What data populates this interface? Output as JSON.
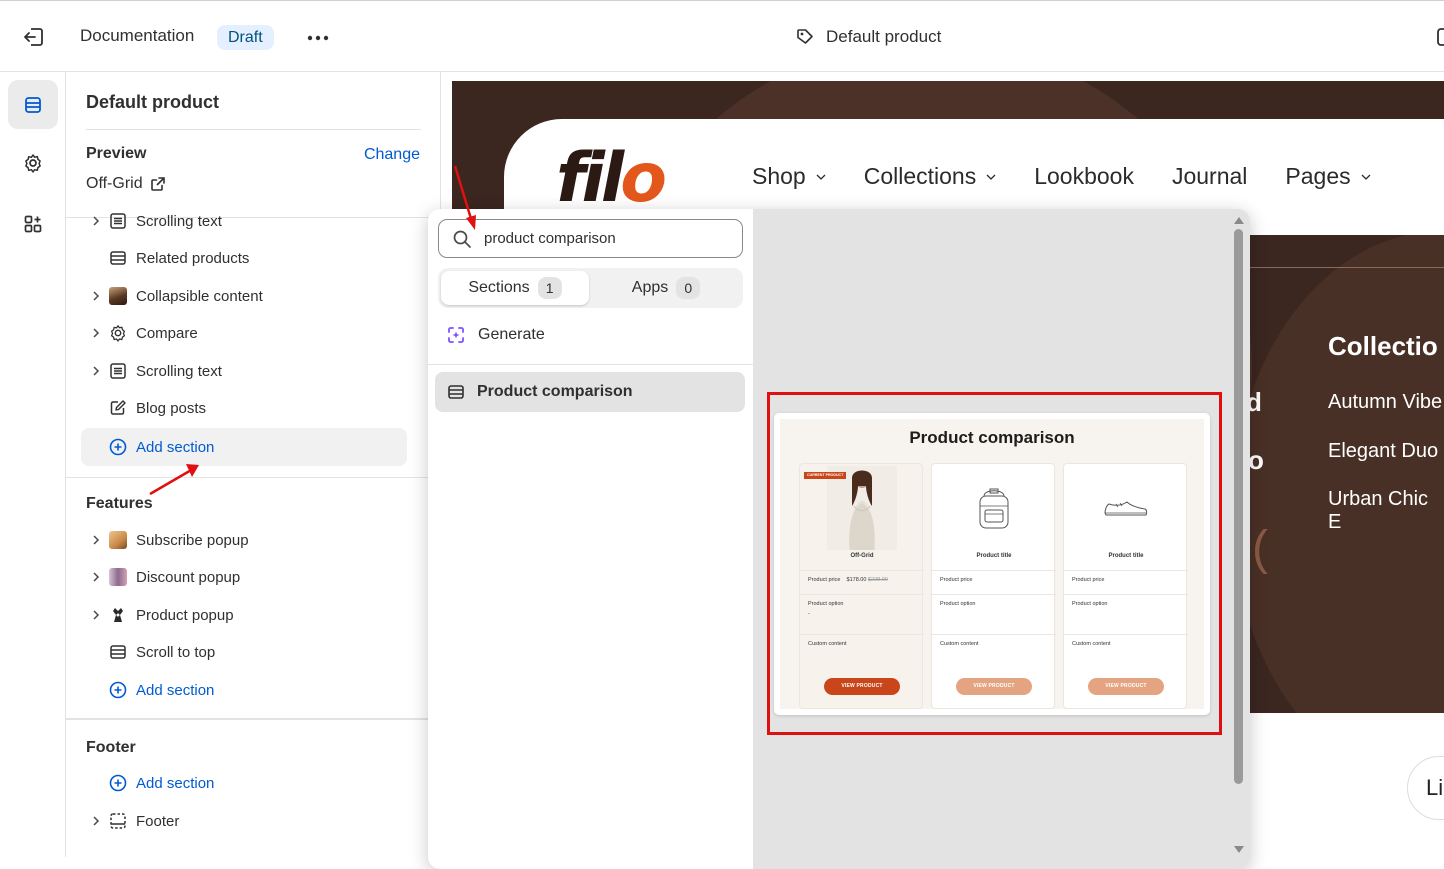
{
  "topbar": {
    "doc_title": "Documentation",
    "status_badge": "Draft",
    "page_title": "Default product"
  },
  "sidebar": {
    "title": "Default product",
    "preview_label": "Preview",
    "change_link": "Change",
    "preview_value": "Off-Grid",
    "template_items": [
      {
        "label": "Scrolling text",
        "icon": "list-icon"
      },
      {
        "label": "Related products",
        "icon": "section-icon"
      },
      {
        "label": "Collapsible content",
        "icon": "image-thumb"
      },
      {
        "label": "Compare",
        "icon": "gear-icon"
      },
      {
        "label": "Scrolling text",
        "icon": "list-icon"
      },
      {
        "label": "Blog posts",
        "icon": "blog-icon"
      }
    ],
    "add_section": "Add section",
    "features_title": "Features",
    "feature_items": [
      {
        "label": "Subscribe popup",
        "icon": "image-thumb"
      },
      {
        "label": "Discount popup",
        "icon": "image-thumb"
      },
      {
        "label": "Product popup",
        "icon": "image-thumb"
      },
      {
        "label": "Scroll to top",
        "icon": "section-icon"
      }
    ],
    "features_add_section": "Add section",
    "footer_title": "Footer",
    "footer_add_section": "Add section",
    "footer_item": "Footer"
  },
  "site": {
    "logo_text": "fil",
    "logo_accent": "o",
    "menu": [
      {
        "label": "Shop",
        "dropdown": true
      },
      {
        "label": "Collections",
        "dropdown": true
      },
      {
        "label": "Lookbook",
        "dropdown": false
      },
      {
        "label": "Journal",
        "dropdown": false
      },
      {
        "label": "Pages",
        "dropdown": true
      }
    ],
    "collections_title": "Collectio",
    "collections": [
      "Autumn Vibe",
      "Elegant Duo",
      "Urban Chic E"
    ],
    "partial_1": "d",
    "partial_2": "o",
    "partial_3": "(",
    "chat_label": "Li"
  },
  "popover": {
    "search_value": "product comparison",
    "tabs": {
      "sections_label": "Sections",
      "sections_count": "1",
      "apps_label": "Apps",
      "apps_count": "0"
    },
    "generate_label": "Generate",
    "result_label": "Product comparison"
  },
  "preview_card": {
    "title": "Product comparison",
    "current_badge": "CURRENT PRODUCT",
    "columns": [
      {
        "name": "Off-Grid",
        "price_label": "Product price",
        "price": "$178.00",
        "compare_price": "$228.00",
        "option_label": "Product option",
        "option_value": "-",
        "custom_label": "Custom content",
        "button": "VIEW PRODUCT",
        "button_color": "#c9461a"
      },
      {
        "name": "Product title",
        "price_label": "Product price",
        "price": "",
        "compare_price": "",
        "option_label": "Product option",
        "option_value": "",
        "custom_label": "Custom content",
        "button": "VIEW PRODUCT",
        "button_color": "#e4a482"
      },
      {
        "name": "Product title",
        "price_label": "Product price",
        "price": "",
        "compare_price": "",
        "option_label": "Product option",
        "option_value": "",
        "custom_label": "Custom content",
        "button": "VIEW PRODUCT",
        "button_color": "#e4a482"
      }
    ]
  },
  "colors": {
    "accent_link": "#005bd3",
    "brand_orange": "#e4571c",
    "site_bg": "#3b2620",
    "annotation_red": "#e01010"
  }
}
